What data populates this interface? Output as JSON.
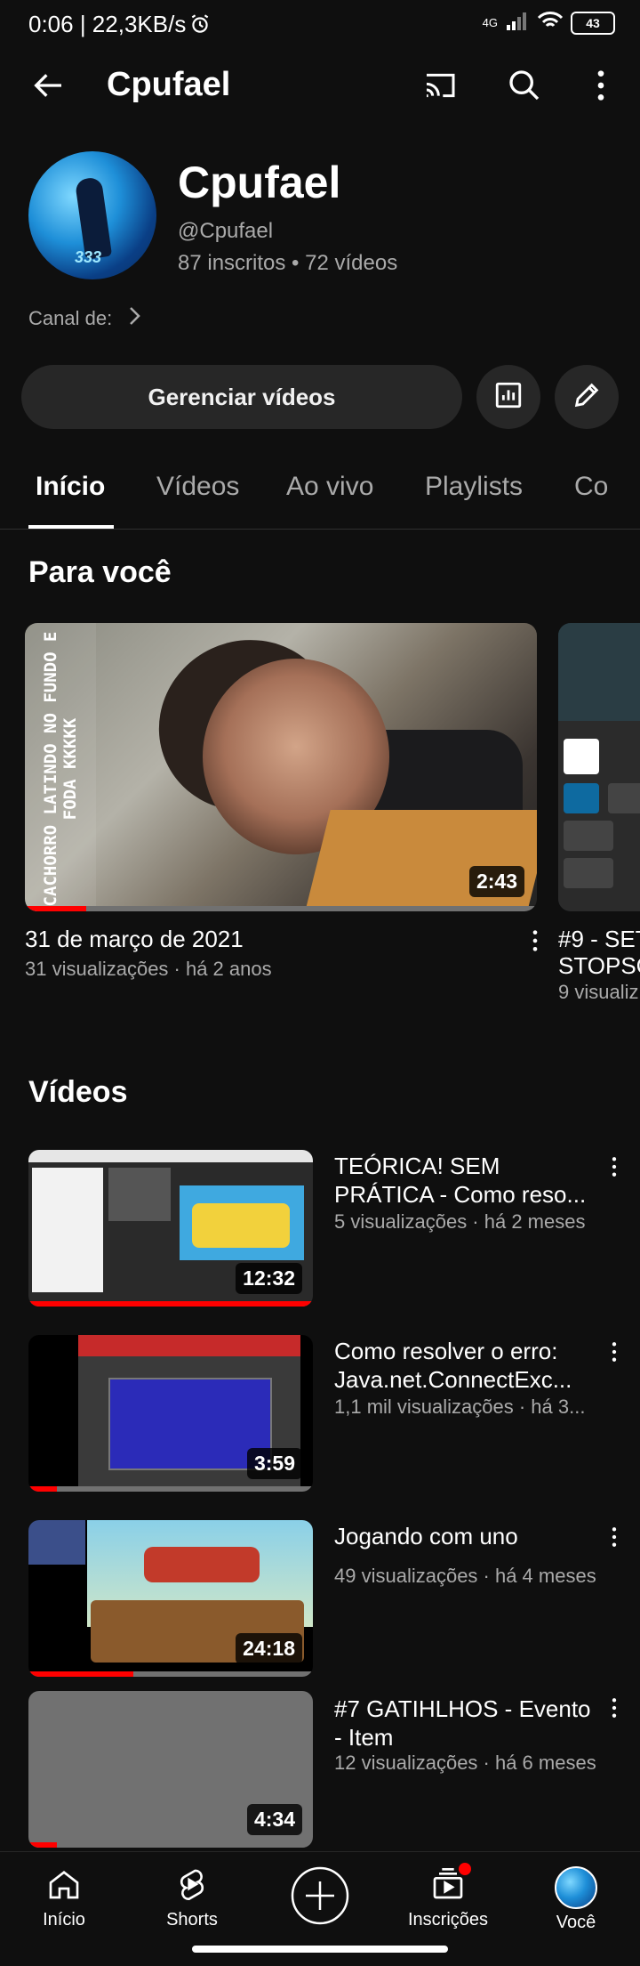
{
  "status_bar": {
    "time": "0:06 | 22,3KB/s",
    "network": "4G",
    "battery": "43"
  },
  "header": {
    "title": "Cpufael"
  },
  "channel": {
    "name": "Cpufael",
    "handle": "@Cpufael",
    "stats": "87 inscritos • 72 vídeos",
    "canal_de": "Canal de:",
    "manage_button": "Gerenciar vídeos"
  },
  "tabs": [
    "Início",
    "Vídeos",
    "Ao vivo",
    "Playlists",
    "Co"
  ],
  "for_you": {
    "heading": "Para você",
    "featured": {
      "title": "31 de março de 2021",
      "meta": "31 visualizações · há 2 anos",
      "duration": "2:43",
      "overlay_text": "CACHORRO LATINDO NO FUNDO E FODA KKKKK",
      "progress": 0.12
    },
    "peek": {
      "title_line1": "#9 - SET",
      "title_line2": "STOPSC",
      "meta": "9 visualiz"
    }
  },
  "videos": {
    "heading": "Vídeos",
    "items": [
      {
        "title": "TEÓRICA! SEM PRÁTICA - Como reso...",
        "meta": "5 visualizações · há 2 meses",
        "duration": "12:32",
        "progress": 1.0
      },
      {
        "title": "Como resolver o erro: Java.net.ConnectExc...",
        "meta": "1,1 mil visualizações · há 3...",
        "duration": "3:59",
        "progress": 0.1
      },
      {
        "title": "Jogando com uno",
        "meta": "49 visualizações · há 4 meses",
        "duration": "24:18",
        "progress": 0.37
      },
      {
        "title": "#7 GATIHLHOS - Evento - Item",
        "meta": "12 visualizações · há 6 meses",
        "duration": "4:34",
        "progress": 0.1
      }
    ]
  },
  "bottom_nav": {
    "home": "Início",
    "shorts": "Shorts",
    "subscriptions": "Inscrições",
    "you": "Você"
  },
  "colors": {
    "background": "#0f0f0f",
    "accent": "#ff0000",
    "chip": "#272727"
  }
}
